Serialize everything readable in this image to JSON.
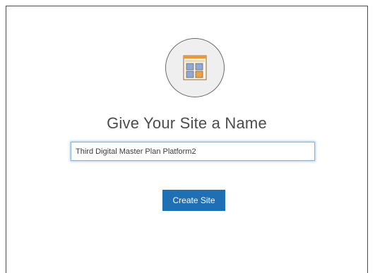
{
  "dialog": {
    "icon": "site-layout-icon",
    "title": "Give Your Site a Name",
    "name_input_value": "Third Digital Master Plan Platform2",
    "create_button_label": "Create Site"
  },
  "colors": {
    "accent": "#1f6fb5",
    "input_focus": "#8fb4d6",
    "icon_orange": "#f0a040",
    "icon_blue": "#8fa8d8"
  }
}
